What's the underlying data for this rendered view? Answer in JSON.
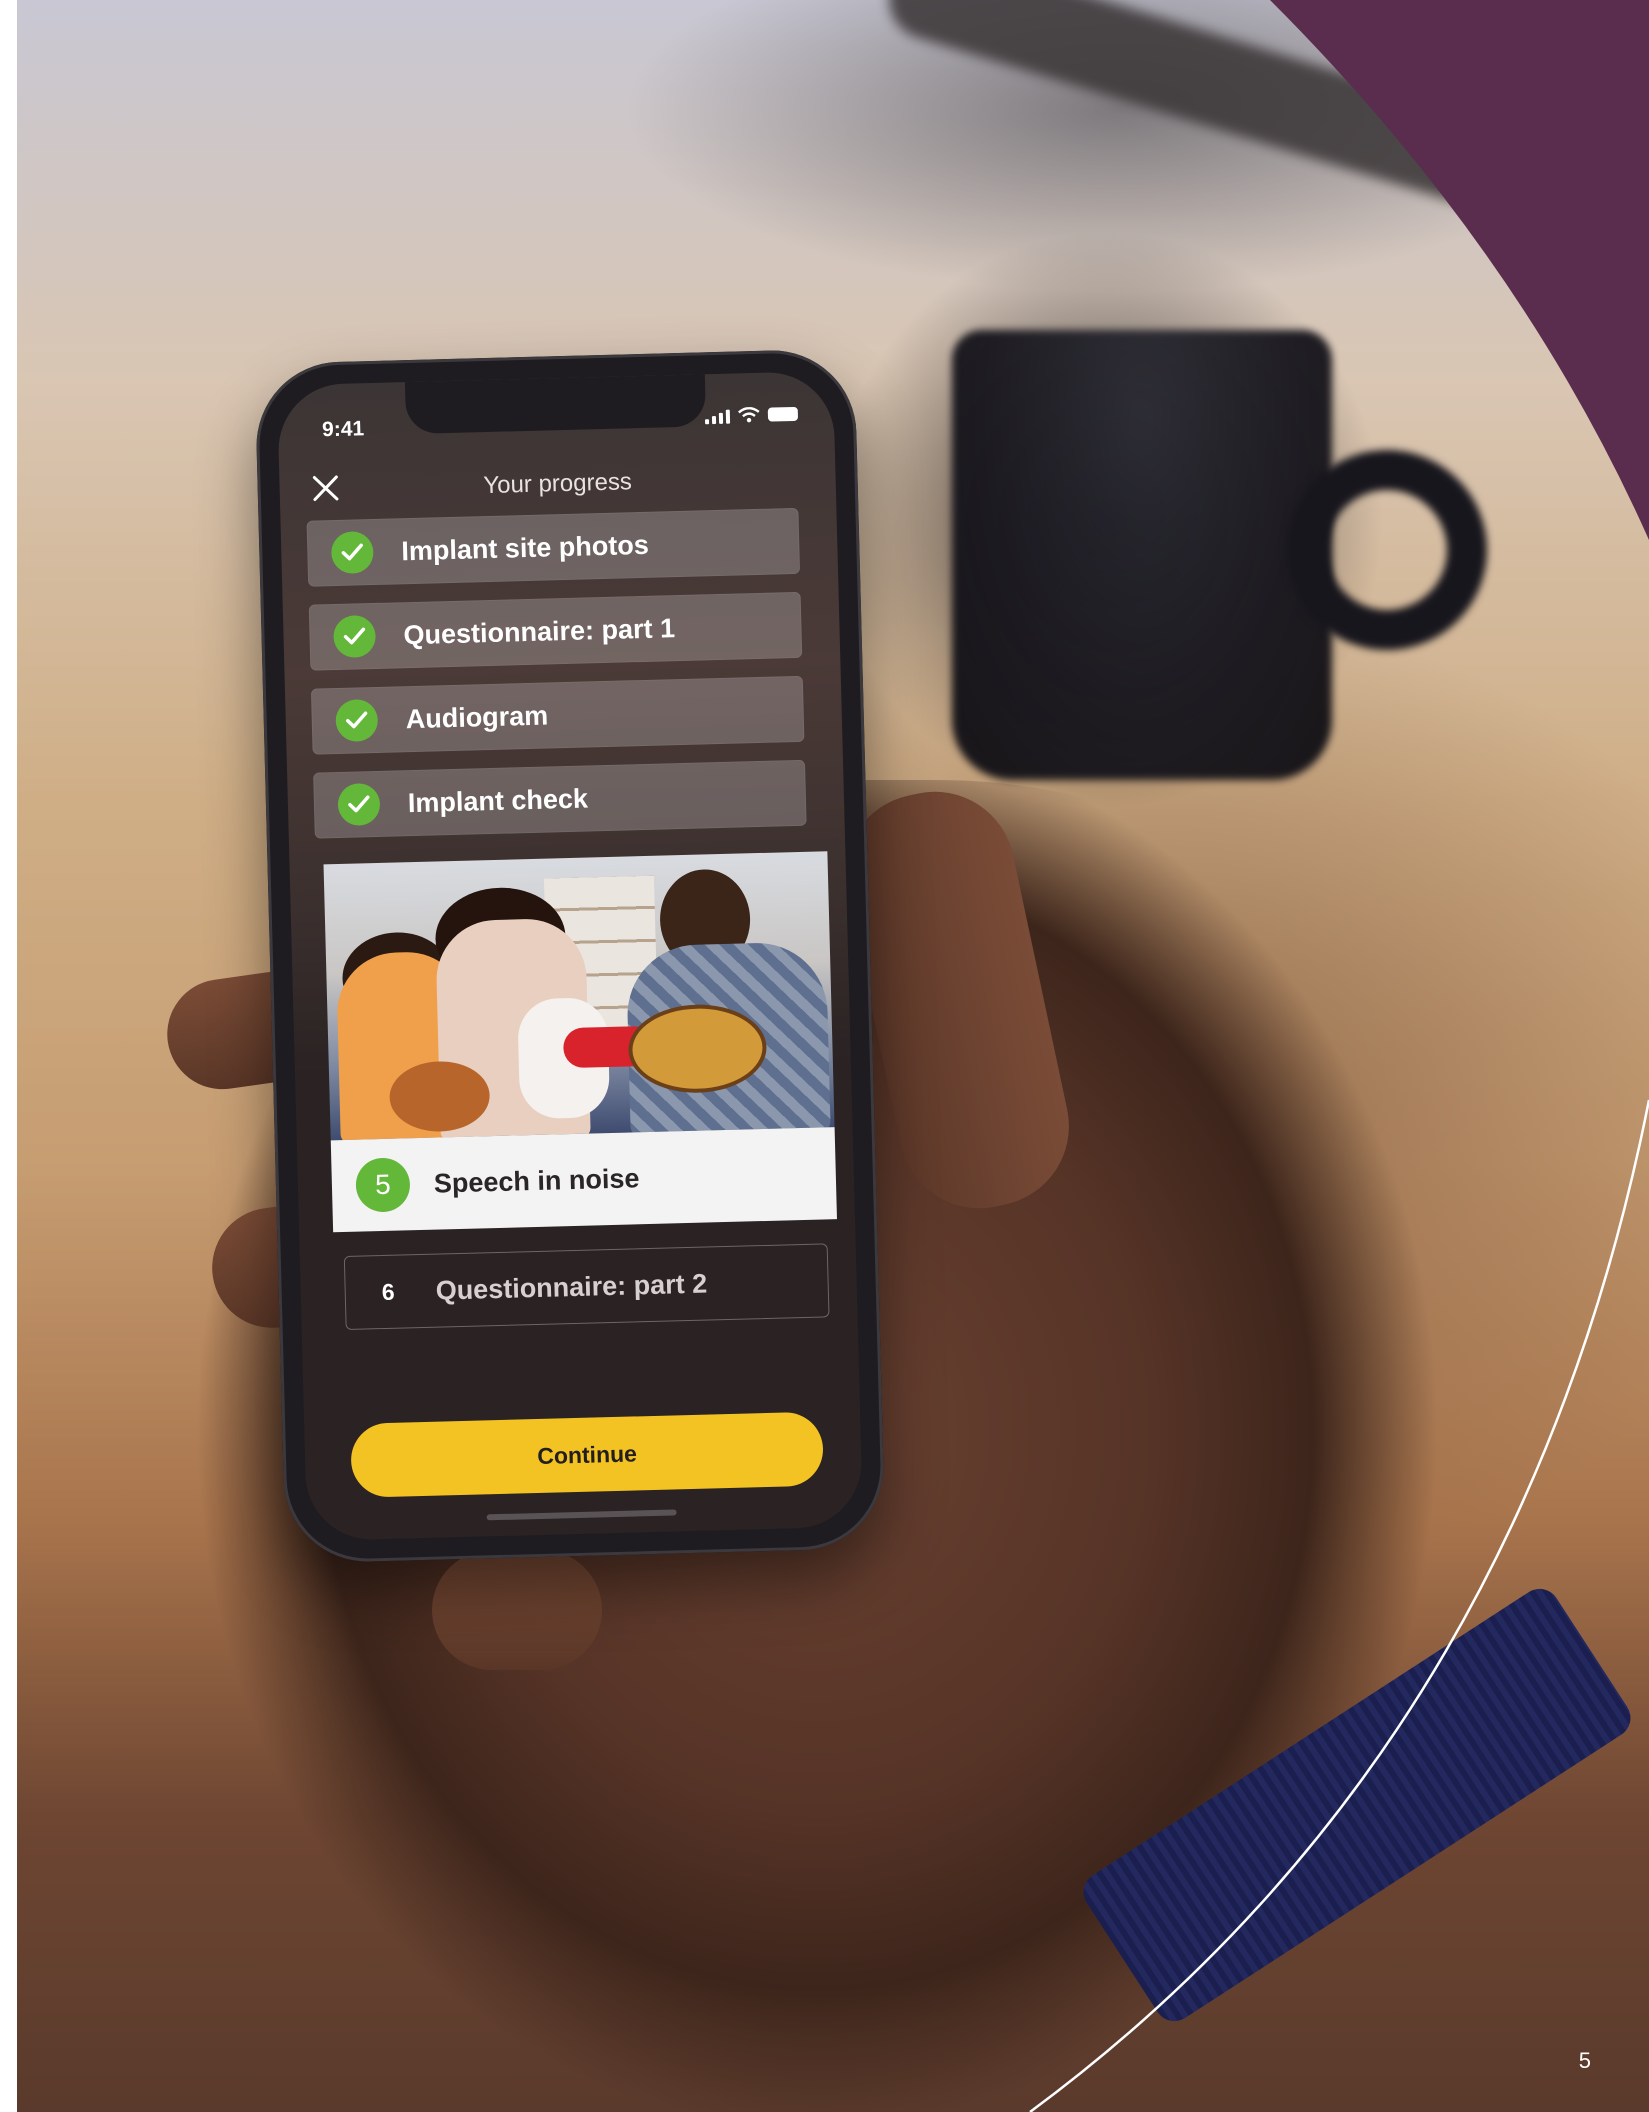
{
  "page": {
    "number": "5",
    "colors": {
      "accent_purple": "#5a2d4f",
      "arc_line": "#ffffff"
    }
  },
  "phone": {
    "status_bar": {
      "time": "9:41",
      "icons": [
        "signal-icon",
        "wifi-icon",
        "battery-icon"
      ]
    },
    "header": {
      "title": "Your progress",
      "close_icon": "close-icon"
    },
    "steps": [
      {
        "label": "Implant site photos",
        "status": "completed",
        "icon": "check-icon"
      },
      {
        "label": "Questionnaire: part 1",
        "status": "completed",
        "icon": "check-icon"
      },
      {
        "label": "Audiogram",
        "status": "completed",
        "icon": "check-icon"
      },
      {
        "label": "Implant check",
        "status": "completed",
        "icon": "check-icon"
      },
      {
        "number": "5",
        "label": "Speech in noise",
        "status": "current"
      },
      {
        "number": "6",
        "label": "Questionnaire: part 2",
        "status": "upcoming"
      }
    ],
    "continue_label": "Continue",
    "colors": {
      "check_green": "#63b83a",
      "button_yellow": "#f3c324"
    }
  }
}
